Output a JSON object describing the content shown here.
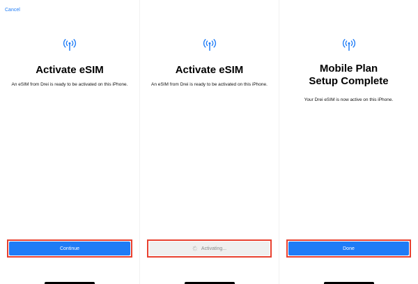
{
  "screens": [
    {
      "cancel_label": "Cancel",
      "title": "Activate eSIM",
      "subtitle": "An eSIM from Drei is ready to be activated on this iPhone.",
      "button_label": "Continue"
    },
    {
      "title": "Activate eSIM",
      "subtitle": "An eSIM from Drei is ready to be activated on this iPhone.",
      "button_label": "Activating..."
    },
    {
      "title_line1": "Mobile Plan",
      "title_line2": "Setup Complete",
      "subtitle": "Your Drei eSIM is now active on this iPhone.",
      "button_label": "Done"
    }
  ],
  "icons": {
    "header": "antenna-signal-icon",
    "loading": "spinner-icon"
  },
  "colors": {
    "accent": "#1f7cf6",
    "highlight_border": "#e8402f",
    "disabled_bg": "#efefef"
  }
}
